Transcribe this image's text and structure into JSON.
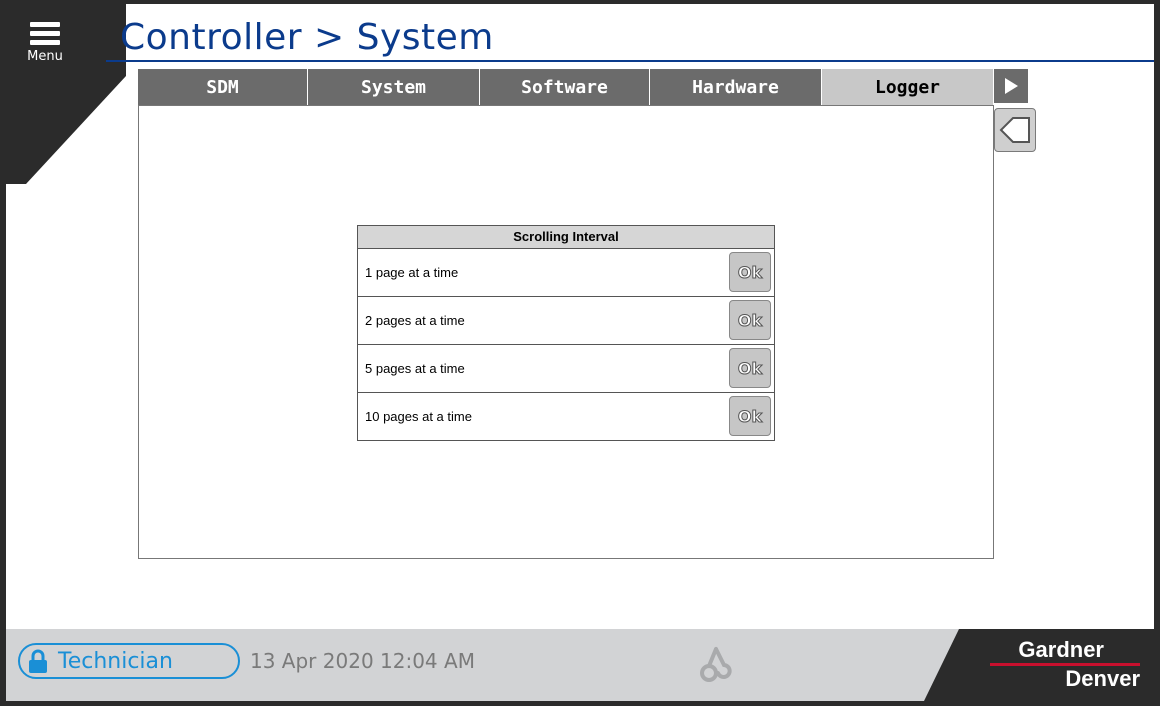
{
  "header": {
    "menu_label": "Menu",
    "title": "Controller > System"
  },
  "tabs": [
    {
      "label": "SDM",
      "active": false
    },
    {
      "label": "System",
      "active": false
    },
    {
      "label": "Software",
      "active": false
    },
    {
      "label": "Hardware",
      "active": false
    },
    {
      "label": "Logger",
      "active": true
    }
  ],
  "scrolling_interval": {
    "title": "Scrolling Interval",
    "options": [
      {
        "label": "1 page at a time",
        "button": "Ok"
      },
      {
        "label": "2 pages at a time",
        "button": "Ok"
      },
      {
        "label": "5 pages at a time",
        "button": "Ok"
      },
      {
        "label": "10 pages at a time",
        "button": "Ok"
      }
    ]
  },
  "footer": {
    "role": "Technician",
    "datetime": "13 Apr 2020  12:04 AM",
    "brand_line1": "Gardner",
    "brand_line2": "Denver"
  },
  "colors": {
    "title_blue": "#0b3b8c",
    "role_blue": "#1a8fd6",
    "brand_red": "#c8102e",
    "dark": "#2b2b2b"
  }
}
